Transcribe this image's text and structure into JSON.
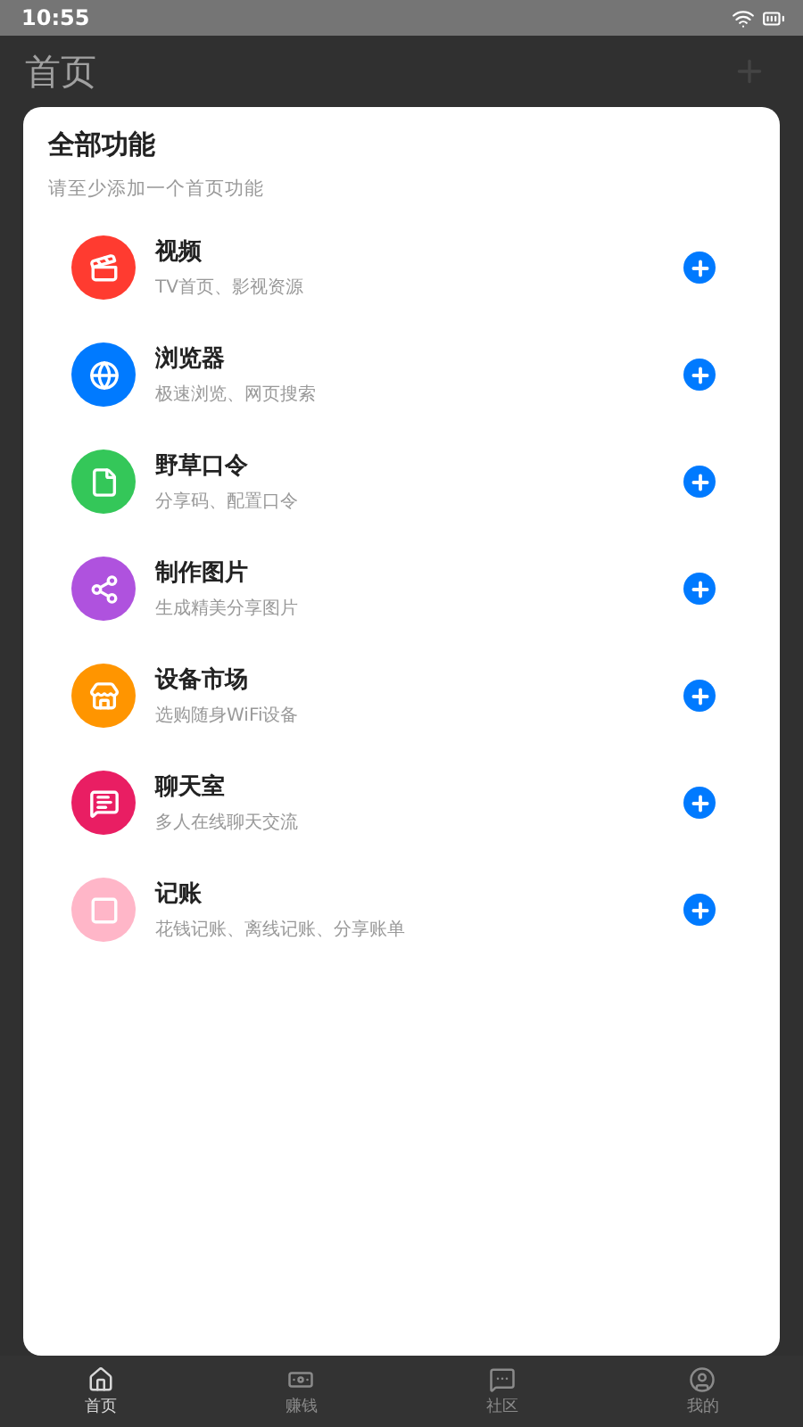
{
  "status_bar": {
    "time": "10:55"
  },
  "header": {
    "title": "首页"
  },
  "dialog": {
    "title": "全部功能",
    "subtitle": "请至少添加一个首页功能",
    "items": [
      {
        "name": "视频",
        "description": "TV首页、影视资源",
        "color": "#ff3b30"
      },
      {
        "name": "浏览器",
        "description": "极速浏览、网页搜索",
        "color": "#007aff"
      },
      {
        "name": "野草口令",
        "description": "分享码、配置口令",
        "color": "#34c759"
      },
      {
        "name": "制作图片",
        "description": "生成精美分享图片",
        "color": "#af52de"
      },
      {
        "name": "设备市场",
        "description": "选购随身WiFi设备",
        "color": "#ff9500"
      },
      {
        "name": "聊天室",
        "description": "多人在线聊天交流",
        "color": "#e91e63"
      },
      {
        "name": "记账",
        "description": "花钱记账、离线记账、分享账单",
        "color": "#ffb6c8"
      }
    ]
  },
  "bottom_nav": [
    {
      "label": "首页",
      "selected": true
    },
    {
      "label": "赚钱",
      "selected": false
    },
    {
      "label": "社区",
      "selected": false
    },
    {
      "label": "我的",
      "selected": false
    }
  ]
}
